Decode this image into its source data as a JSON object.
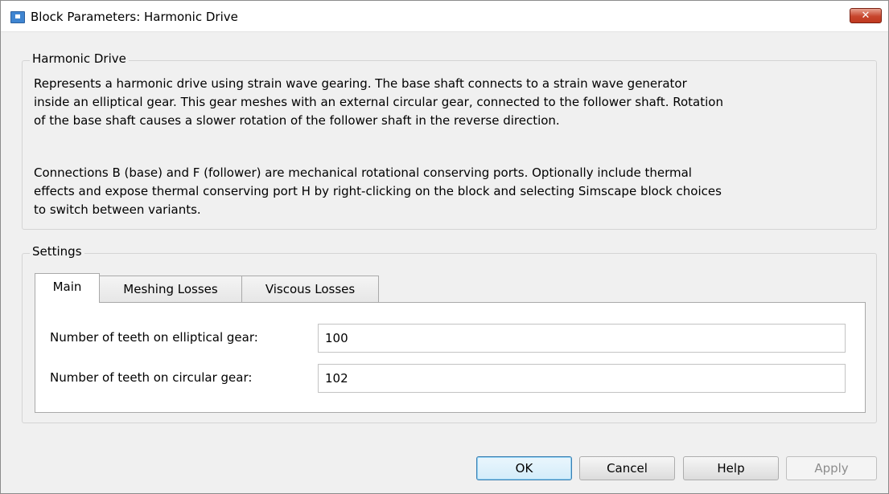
{
  "window": {
    "title": "Block Parameters: Harmonic Drive",
    "close_label": "✕"
  },
  "description_group": {
    "title": "Harmonic Drive",
    "paragraphs": [
      [
        "Represents a harmonic drive using strain wave gearing. The base shaft connects to a strain wave generator",
        "inside an elliptical gear. This gear meshes with an external circular gear, connected to the follower shaft. Rotation",
        "of the base shaft causes a slower rotation of the follower shaft in the reverse direction."
      ],
      [
        "Connections B (base) and F (follower) are mechanical rotational conserving ports. Optionally include thermal",
        "effects and expose thermal conserving port H by right-clicking on the block and selecting Simscape block choices",
        "to switch between variants."
      ]
    ]
  },
  "settings": {
    "title": "Settings",
    "tabs": [
      {
        "label": "Main",
        "active": true
      },
      {
        "label": "Meshing Losses",
        "active": false
      },
      {
        "label": "Viscous Losses",
        "active": false
      }
    ],
    "parameters": [
      {
        "label": "Number of teeth on elliptical gear:",
        "value": "100"
      },
      {
        "label": "Number of teeth on circular gear:",
        "value": "102"
      }
    ]
  },
  "buttons": {
    "ok": "OK",
    "cancel": "Cancel",
    "help": "Help",
    "apply": "Apply"
  },
  "icons": {
    "app": "simulink-block-icon",
    "close": "close-icon"
  }
}
